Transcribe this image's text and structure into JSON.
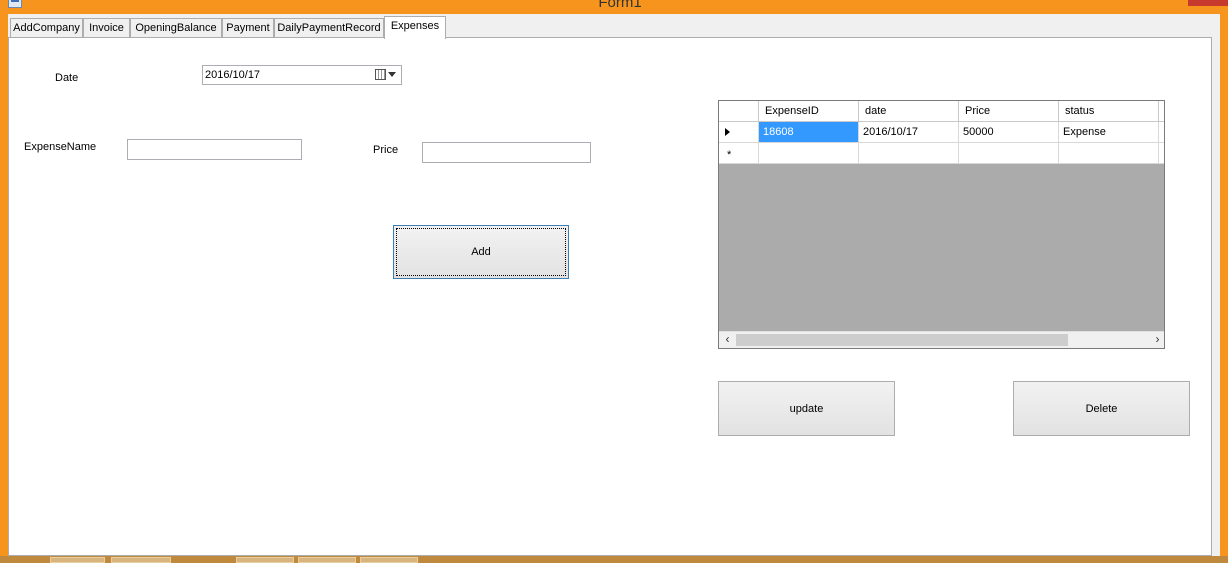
{
  "window": {
    "title": "Form1"
  },
  "tabs": [
    {
      "label": "AddCompany"
    },
    {
      "label": "Invoice"
    },
    {
      "label": "OpeningBalance"
    },
    {
      "label": "Payment"
    },
    {
      "label": "DailyPaymentRecord"
    },
    {
      "label": "Expenses",
      "active": true
    }
  ],
  "form": {
    "date_label": "Date",
    "date_value": "2016/10/17",
    "expense_name_label": "ExpenseName",
    "expense_name_value": "",
    "price_label": "Price",
    "price_value": "",
    "add_label": "Add"
  },
  "grid": {
    "columns": [
      "ExpenseID",
      "date",
      "Price",
      "status"
    ],
    "rows": [
      [
        "18608",
        "2016/10/17",
        "50000",
        "Expense"
      ]
    ],
    "new_row_marker": "*"
  },
  "actions": {
    "update_label": "update",
    "delete_label": "Delete"
  },
  "icons": [
    "app-icon",
    "calendar-icon",
    "dropdown-arrow-icon",
    "row-selector-arrow-icon",
    "scroll-left-icon",
    "scroll-right-icon"
  ],
  "colors": {
    "window_frame": "#f7941d",
    "selection": "#3399ff"
  }
}
